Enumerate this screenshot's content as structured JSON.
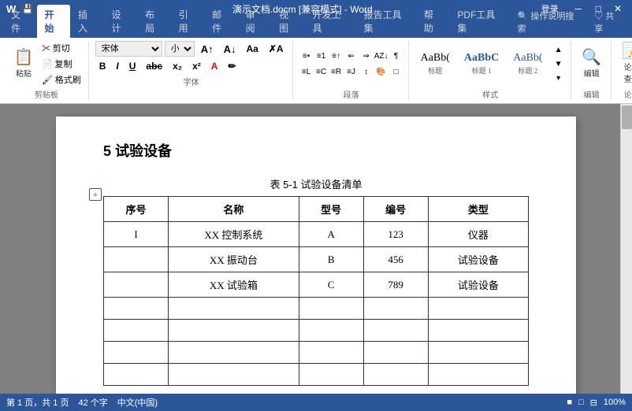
{
  "titlebar": {
    "logo": "W",
    "filename": "演示文档.docm [兼容模式] - Word",
    "login_label": "登录",
    "min_btn": "－",
    "max_btn": "□",
    "close_btn": "✕",
    "quick_save": "💾",
    "undo": "↶",
    "redo": "↷"
  },
  "ribbon": {
    "tabs": [
      "文件",
      "开始",
      "插入",
      "设计",
      "布局",
      "引用",
      "邮件",
      "审阅",
      "视图",
      "开发工具",
      "报告工具集",
      "帮助",
      "PDF工具集",
      "操作说明搜索"
    ],
    "active_tab": "开始",
    "groups": {
      "clipboard": {
        "label": "剪贴板",
        "paste": "粘贴"
      },
      "font": {
        "label": "字体",
        "font_name": "宋体",
        "font_size": "小三",
        "bold": "B",
        "italic": "I",
        "underline": "U",
        "strikethrough": "abc",
        "subscript": "x₂",
        "superscript": "x²"
      },
      "paragraph": {
        "label": "段落"
      },
      "styles": {
        "label": "样式",
        "items": [
          {
            "name": "标题",
            "preview": "AaBb("
          },
          {
            "name": "标题 1",
            "preview": "AaBbC"
          },
          {
            "name": "标题 2",
            "preview": "AaBb("
          }
        ]
      },
      "editing": {
        "label": "编辑",
        "find": "编辑"
      },
      "paper": {
        "label": "论文",
        "check": "论文\n查重"
      }
    },
    "share_btn": "♡ 共享"
  },
  "document": {
    "heading": "5  试验设备",
    "table_caption": "表 5-1  试验设备清单",
    "add_icon": "+",
    "table": {
      "headers": [
        "序号",
        "名称",
        "型号",
        "编号",
        "类型"
      ],
      "rows": [
        {
          "seq": "I",
          "name": "XX 控制系统",
          "model": "A",
          "number": "123",
          "type": "仪器"
        },
        {
          "seq": "",
          "name": "XX 振动台",
          "model": "B",
          "number": "456",
          "type": "试验设备"
        },
        {
          "seq": "",
          "name": "XX 试验箱",
          "model": "C",
          "number": "789",
          "type": "试验设备"
        },
        {
          "seq": "",
          "name": "",
          "model": "",
          "number": "",
          "type": ""
        },
        {
          "seq": "",
          "name": "",
          "model": "",
          "number": "",
          "type": ""
        },
        {
          "seq": "",
          "name": "",
          "model": "",
          "number": "",
          "type": ""
        },
        {
          "seq": "",
          "name": "",
          "model": "",
          "number": "",
          "type": ""
        }
      ]
    }
  },
  "statusbar": {
    "page_info": "第 1 页，共 1 页",
    "word_count": "42 个字",
    "language": "中文(中国)",
    "view_icons": [
      "■",
      "□",
      "⊟"
    ],
    "zoom": "100%"
  },
  "colors": {
    "accent": "#2b579a",
    "ribbon_bg": "#2b579a",
    "active_tab_bg": "#ffffff",
    "doc_bg": "#808080"
  }
}
